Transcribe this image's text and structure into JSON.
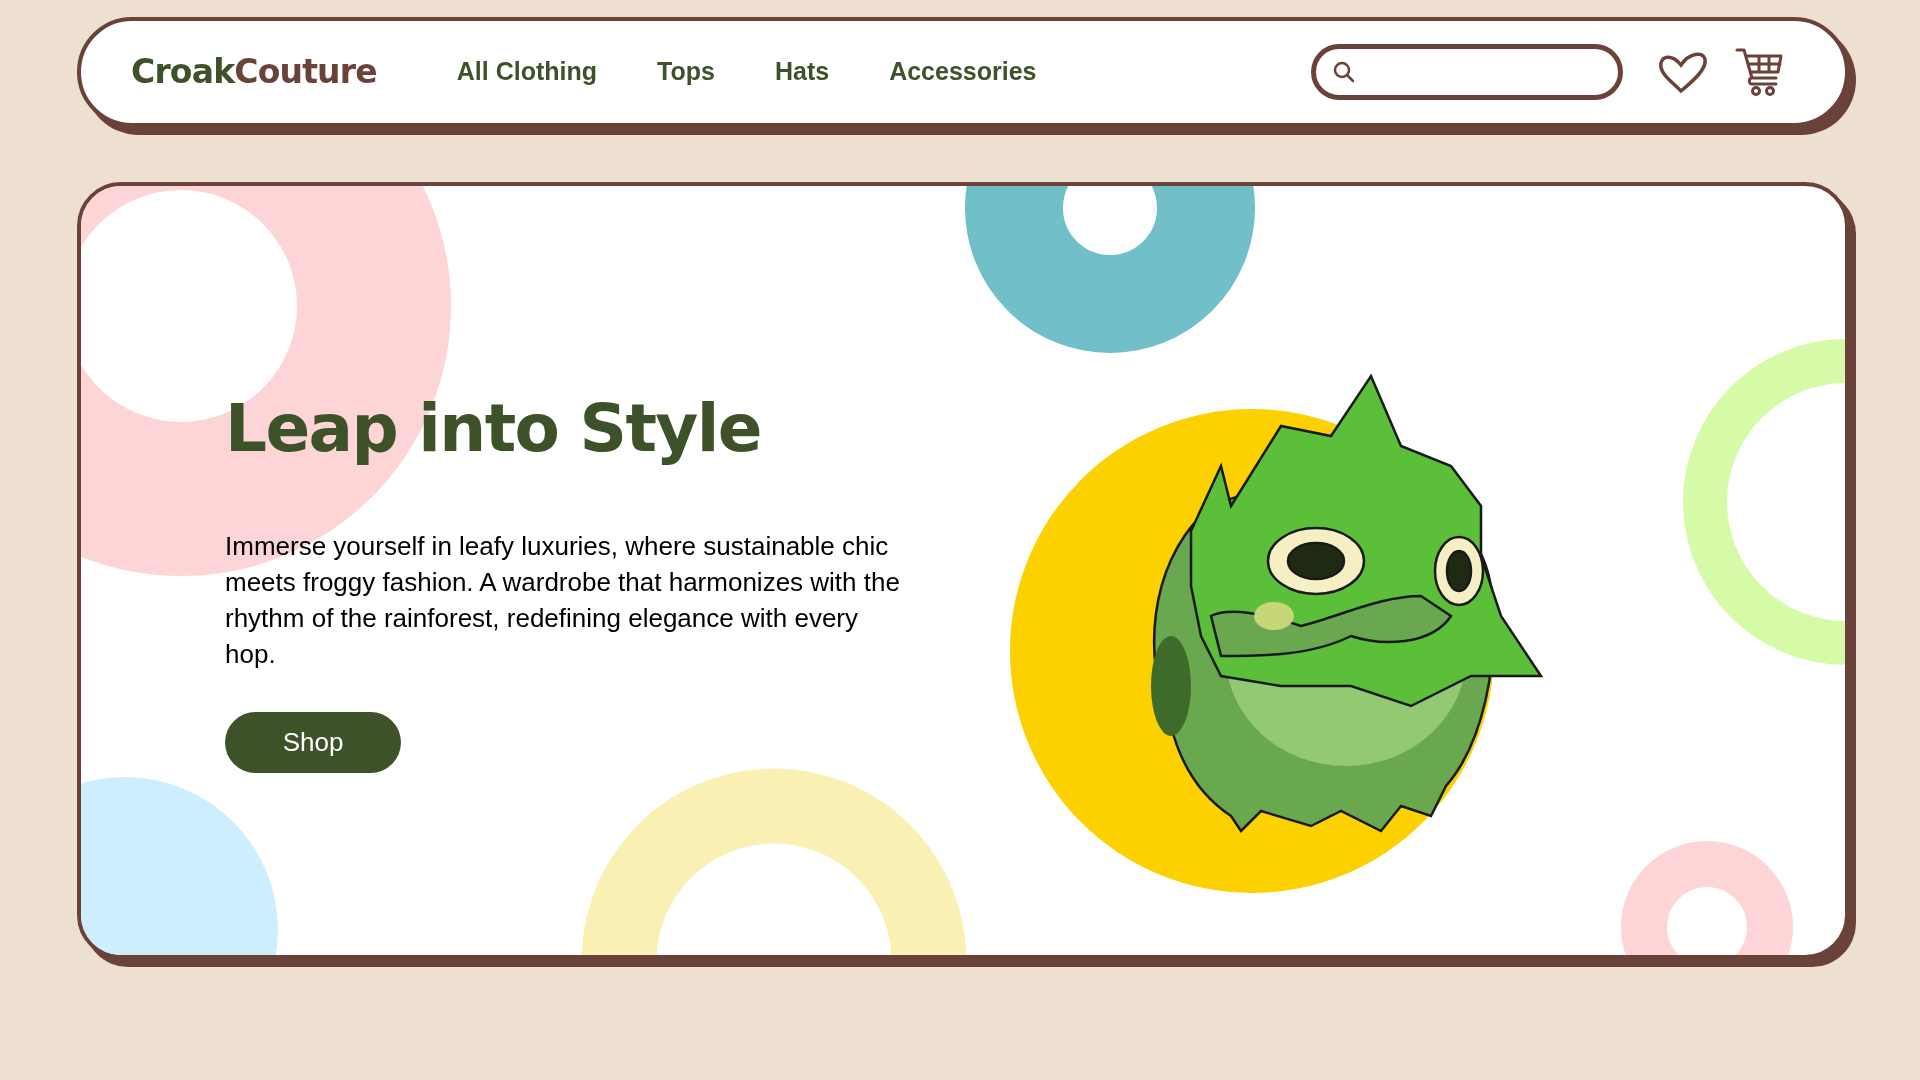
{
  "header": {
    "logo": [
      {
        "text": "Croak",
        "color": "#3d5229"
      },
      {
        "text": "Couture",
        "color": "#6b4239"
      }
    ],
    "nav": [
      "All Clothing",
      "Tops",
      "Hats",
      "Accessories"
    ]
  },
  "hero": {
    "title": "Leap into Style",
    "body": "Immerse yourself in leafy luxuries, where sustainable chic meets froggy fashion. A wardrobe that harmonizes with the rhythm of the rainforest, redefining elegance with every hop.",
    "button": "Shop"
  }
}
